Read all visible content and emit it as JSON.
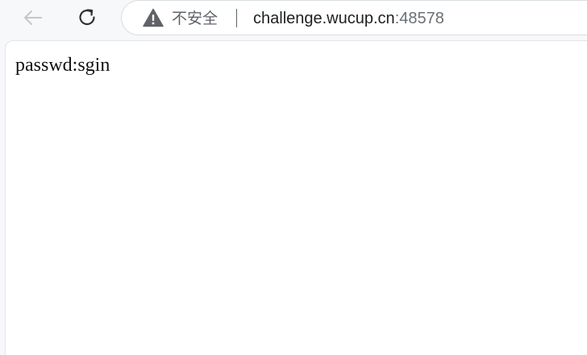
{
  "toolbar": {
    "back_icon": "arrow-left-icon",
    "reload_icon": "reload-icon"
  },
  "address_bar": {
    "security_icon": "warning-triangle-icon",
    "security_label": "不安全",
    "host": "challenge.wucup.cn",
    "port": ":48578"
  },
  "page": {
    "body_text": "passwd:sgin"
  },
  "colors": {
    "toolbar_bg": "#f7f8fa",
    "page_bg": "#ffffff",
    "muted_text": "#5f6368",
    "text": "#202124"
  }
}
